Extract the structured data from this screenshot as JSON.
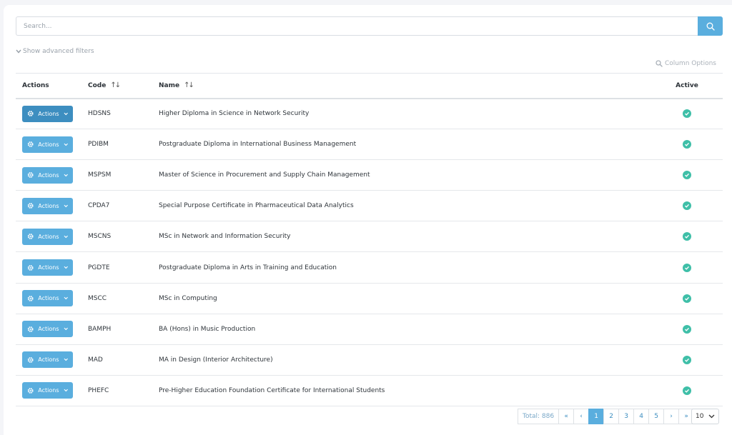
{
  "search": {
    "placeholder": "Search..."
  },
  "filters": {
    "advanced_label": "Show advanced filters"
  },
  "column_options_label": "Column Options",
  "table": {
    "headers": {
      "actions": "Actions",
      "code": "Code",
      "name": "Name",
      "active": "Active"
    },
    "sort_glyph": "↑↓",
    "action_label": "Actions",
    "rows": [
      {
        "code": "HDSNS",
        "name": "Higher Diploma in Science in Network Security",
        "active": true
      },
      {
        "code": "PDIBM",
        "name": "Postgraduate Diploma in International Business Management",
        "active": true
      },
      {
        "code": "MSPSM",
        "name": "Master of Science in Procurement and Supply Chain Management",
        "active": true
      },
      {
        "code": "CPDA7",
        "name": "Special Purpose Certificate in Pharmaceutical Data Analytics",
        "active": true
      },
      {
        "code": "MSCNS",
        "name": "MSc in Network and Information Security",
        "active": true
      },
      {
        "code": "PGDTE",
        "name": "Postgraduate Diploma in Arts in Training and Education",
        "active": true
      },
      {
        "code": "MSCC",
        "name": "MSc in Computing",
        "active": true
      },
      {
        "code": "BAMPH",
        "name": "BA (Hons) in Music Production",
        "active": true
      },
      {
        "code": "MAD",
        "name": "MA in Design (Interior Architecture)",
        "active": true
      },
      {
        "code": "PHEFC",
        "name": "Pre-Higher Education Foundation Certificate for International Students",
        "active": true
      }
    ]
  },
  "pagination": {
    "total": "Total: 886",
    "first": "«",
    "prev": "‹",
    "pages": [
      "1",
      "2",
      "3",
      "4",
      "5"
    ],
    "current": "1",
    "next": "›",
    "last": "»",
    "per_page": "10"
  },
  "colors": {
    "accent": "#5aaede",
    "accent_dark": "#3d8ec0",
    "active_check": "#3fbfa8"
  }
}
